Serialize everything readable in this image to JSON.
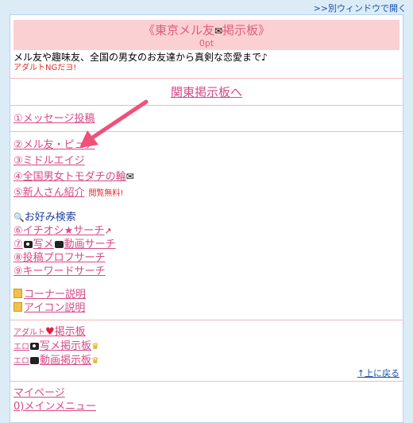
{
  "top": {
    "new_window": ">>別ウィンドウで開く"
  },
  "header": {
    "title_prefix": "《東京メル友",
    "title_suffix": "掲示板》",
    "points": "0pt",
    "description": "メル友や趣味友、全国の男女のお友達から真剣な恋愛まで♪",
    "ng_note": "アダルトNGだヨ!"
  },
  "region_link": "関東掲示板へ",
  "menu1": {
    "post": "①メッセージ投稿"
  },
  "menu2": {
    "item2": "②メル友・ピュア",
    "item3": "③ミドルエイジ",
    "item4": "④全国男女トモダチの輪",
    "item5": "⑤新人さん紹介",
    "item5_note": "閲覧無料!"
  },
  "search": {
    "heading": "お好み検索",
    "item6": "⑥イチオシ★サーチ",
    "item7_prefix": "⑦",
    "item7_a": "写メ",
    "item7_b": "動画サーチ",
    "item8": "⑧投稿プロフサーチ",
    "item9": "⑨キーワードサーチ"
  },
  "info": {
    "corner": "コーナー説明",
    "icon": "アイコン説明"
  },
  "adult": {
    "board_prefix": "アダルト",
    "board_suffix": "掲示板",
    "photo_prefix": "エロ",
    "photo_suffix": "写メ掲示板",
    "video_prefix": "エロ",
    "video_suffix": "動画掲示板"
  },
  "back_to_top": "↑上に戻る",
  "footer": {
    "mypage": "マイページ",
    "main_menu": "0)メインメニュー"
  },
  "colors": {
    "accent": "#d64a86",
    "header_bg": "#fbd0d2",
    "page_bg": "#dcecf7"
  }
}
